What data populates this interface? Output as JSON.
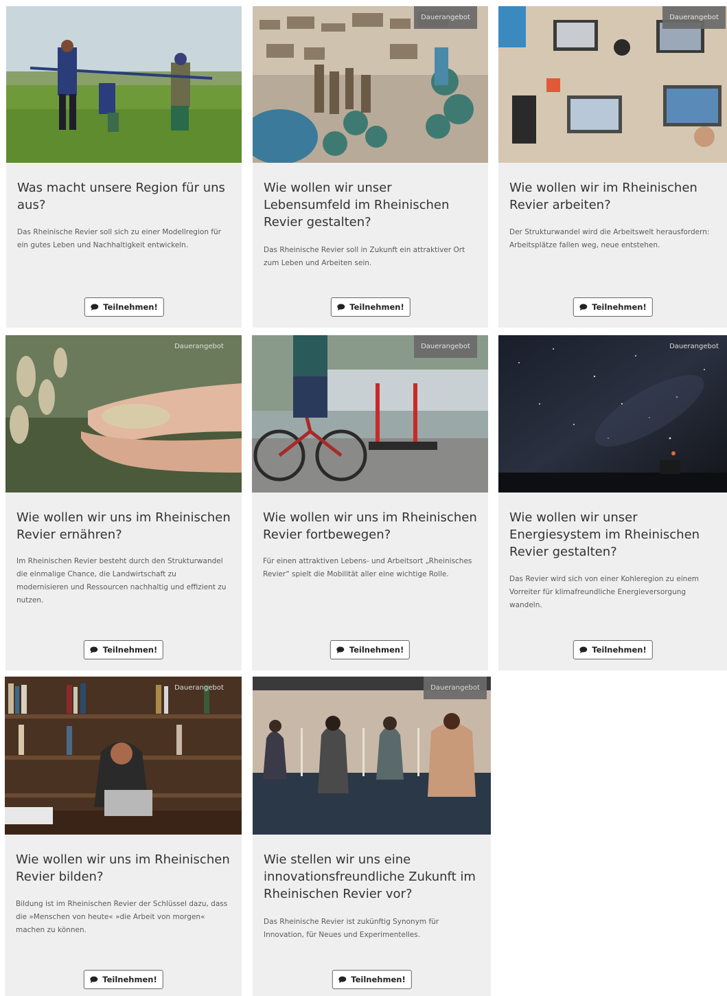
{
  "badge_label": "Dauerangebot",
  "button_label": "Teilnehmen!",
  "cards": [
    {
      "title": "Was macht unsere Region für uns aus?",
      "description": "Das Rheinische Revier soll sich zu einer Modellregion für ein gutes Leben und Nachhaltigkeit entwickeln.",
      "image": "family-field-photo"
    },
    {
      "title": "Wie wollen wir unser Lebensumfeld im Rheinischen Revier gestalten?",
      "description": "Das Rheinische Revier soll in Zukunft ein attraktiver Ort zum Leben und Arbeiten sein.",
      "image": "city-model-photo"
    },
    {
      "title": "Wie wollen wir im Rheinischen Revier arbeiten?",
      "description": "Der Strukturwandel wird die Arbeitswelt herausfordern: Arbeitsplätze fallen weg, neue entstehen.",
      "image": "laptops-table-photo"
    },
    {
      "title": "Wie wollen wir uns im Rheinischen Revier ernähren?",
      "description": "Im Rheinischen Revier besteht durch den Strukturwandel die einmalige Chance, die Landwirtschaft zu modernisieren und Ressourcen nachhaltig und effizient zu nutzen.",
      "image": "grain-hands-photo"
    },
    {
      "title": "Wie wollen wir uns im Rheinischen Revier fortbewegen?",
      "description": "Für einen attraktiven Lebens- und Arbeitsort „Rheinisches Revier“ spielt die Mobilität aller eine wichtige Rolle.",
      "image": "bike-scooter-photo"
    },
    {
      "title": "Wie wollen wir unser Energiesystem im Rheinischen Revier gestalten?",
      "description": "Das Revier wird sich von einer Kohleregion zu einem Vorreiter für klimafreundliche Energieversorgung wandeln.",
      "image": "starry-night-photo"
    },
    {
      "title": "Wie wollen wir uns im Rheinischen Revier bilden?",
      "description": "Bildung ist im Rheinischen Revier der Schlüssel dazu, dass die »Menschen von heute« »die Arbeit von morgen« machen zu können.",
      "image": "library-laptop-photo"
    },
    {
      "title": "Wie stellen wir uns eine innovationsfreundliche Zukunft im Rheinischen Revier vor?",
      "description": "Das Rheinische Revier ist zukünftig Synonym für Innovation, für Neues und Experimentelles.",
      "image": "vr-headsets-photo"
    }
  ],
  "colors": {
    "card_bg": "#efeff0",
    "badge_bg": "#6a6a6a"
  }
}
